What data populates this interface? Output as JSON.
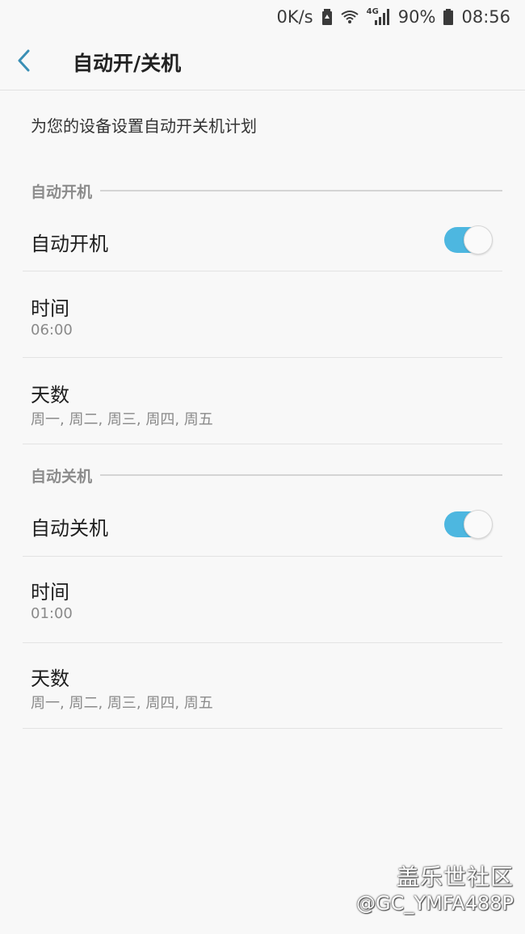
{
  "status_bar": {
    "net_speed": "0K/s",
    "network_type": "4G",
    "battery": "90%",
    "time": "08:56",
    "icons": [
      "battery-saver-icon",
      "wifi-icon",
      "signal-icon",
      "battery-icon"
    ]
  },
  "app_bar": {
    "back_icon": "chevron-left-icon",
    "title": "自动开/关机"
  },
  "description": "为您的设备设置自动开关机计划",
  "power_on": {
    "section_label": "自动开机",
    "toggle_label": "自动开机",
    "enabled": true,
    "time_label": "时间",
    "time_value": "06:00",
    "days_label": "天数",
    "days_value": "周一, 周二, 周三, 周四, 周五"
  },
  "power_off": {
    "section_label": "自动关机",
    "toggle_label": "自动关机",
    "enabled": true,
    "time_label": "时间",
    "time_value": "01:00",
    "days_label": "天数",
    "days_value": "周一, 周二, 周三, 周四, 周五"
  },
  "watermark": {
    "brand": "盖乐世社区",
    "user": "@GC_YMFA488P"
  },
  "colors": {
    "accent": "#4db7e0",
    "back_arrow": "#3a8fb5",
    "background": "#f8f8f8",
    "secondary_text": "#8a8a8a"
  }
}
